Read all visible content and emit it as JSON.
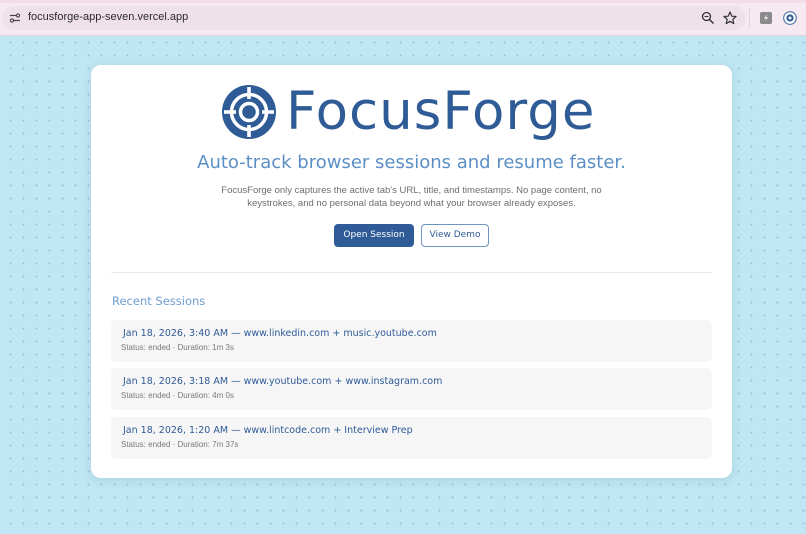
{
  "browser": {
    "url": "focusforge-app-seven.vercel.app",
    "icons": [
      "site-info-icon",
      "zoom-icon",
      "bookmark-star-icon",
      "extension-icon",
      "profile-icon"
    ]
  },
  "hero": {
    "brand": "FocusForge",
    "tagline": "Auto-track browser sessions and resume faster.",
    "privacy_note": "FocusForge only captures the active tab's URL, title, and timestamps. No page content, no keystrokes, and no personal data beyond what your browser already exposes.",
    "primary_button": "Open Session",
    "secondary_button": "View Demo"
  },
  "recent": {
    "title": "Recent Sessions",
    "sessions": [
      {
        "title": "Jan 18, 2026, 3:40 AM — www.linkedin.com + music.youtube.com",
        "meta": "Status: ended · Duration: 1m 3s"
      },
      {
        "title": "Jan 18, 2026, 3:18 AM — www.youtube.com + www.instagram.com",
        "meta": "Status: ended · Duration: 4m 0s"
      },
      {
        "title": "Jan 18, 2026, 1:20 AM — www.lintcode.com + Interview Prep",
        "meta": "Status: ended · Duration: 7m 37s"
      }
    ]
  },
  "colors": {
    "brand": "#2f5b96",
    "accent": "#5b8fc5",
    "page_background": "#bfe6f2"
  }
}
